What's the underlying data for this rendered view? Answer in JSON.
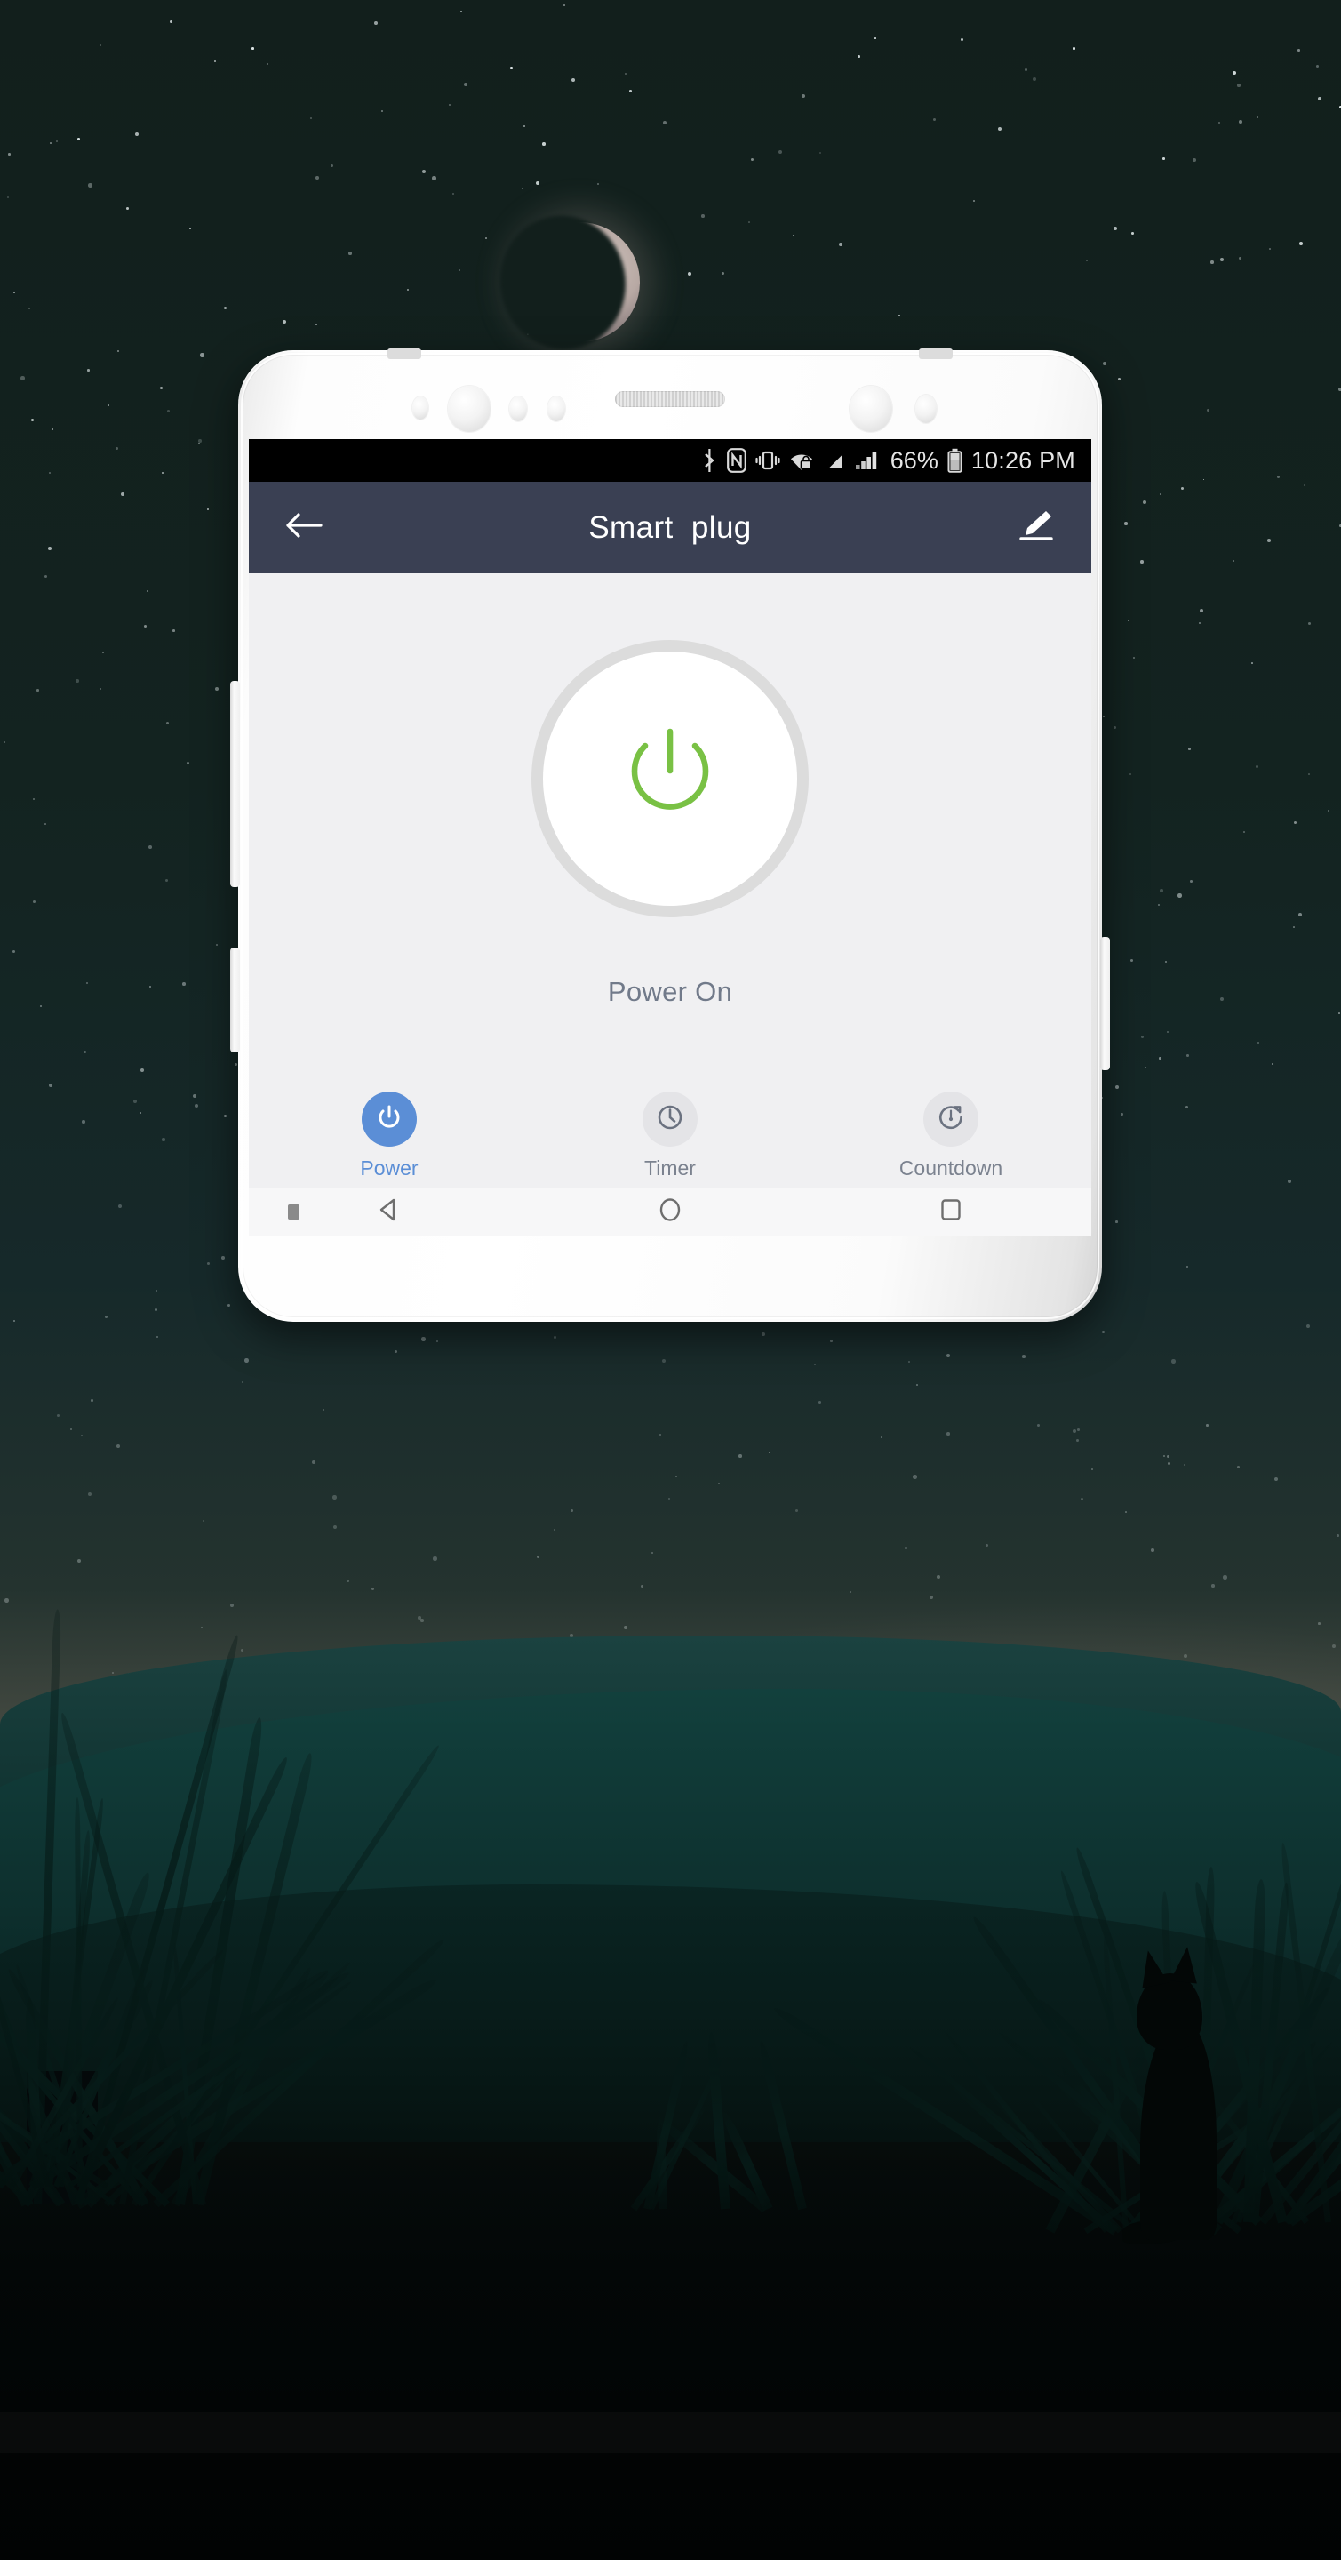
{
  "wallpaper": {
    "scene_name": "night-sky-cat-silhouette-wallpaper",
    "description": "Starry dark teal night sky with crescent moon, grass silhouettes and a cat silhouette"
  },
  "device": {
    "name": "android-phone",
    "body_color": "#ffffff",
    "buttons": [
      "volume-rocker",
      "bixby-button",
      "power-button"
    ]
  },
  "status_bar": {
    "background": "#000000",
    "icons": [
      "bluetooth-icon",
      "nfc-icon",
      "vibrate-icon",
      "wifi-secured-icon",
      "mobile-data-off-icon",
      "signal-bars-icon"
    ],
    "battery_percent": "66%",
    "battery_icon": "battery-icon",
    "time": "10:26 PM"
  },
  "app_bar": {
    "background": "#3a4053",
    "back_icon": "back-arrow-icon",
    "title": "Smart  plug",
    "edit_icon": "edit-pencil-icon"
  },
  "main": {
    "background": "#f0f0f2",
    "power_button": {
      "icon": "power-icon",
      "icon_color": "#79c144",
      "ring_color": "#dcdcdc",
      "fill_color": "#ffffff",
      "state_label": "Power On"
    }
  },
  "tab_bar": {
    "accent_color": "#5b8ed6",
    "inactive_color": "#7b828f",
    "tabs": [
      {
        "label": "Power",
        "icon": "power-icon",
        "active": true
      },
      {
        "label": "Timer",
        "icon": "clock-icon",
        "active": false
      },
      {
        "label": "Countdown",
        "icon": "countdown-icon",
        "active": false
      }
    ]
  },
  "nav_bar": {
    "background": "#f7f7f8",
    "items": [
      "keyboard-hide-indicator",
      "back-triangle-icon",
      "home-circle-icon",
      "recents-square-icon"
    ]
  }
}
